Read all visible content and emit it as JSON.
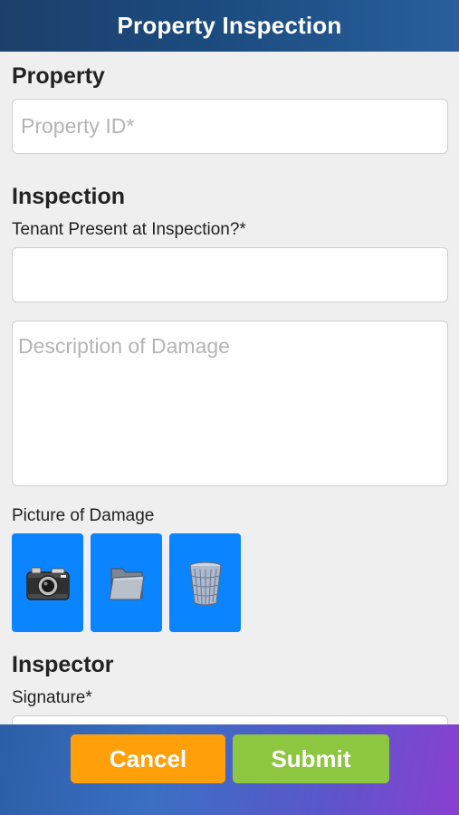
{
  "header": {
    "title": "Property Inspection"
  },
  "property": {
    "section_title": "Property",
    "property_id_placeholder": "Property ID*"
  },
  "inspection": {
    "section_title": "Inspection",
    "tenant_present_label": "Tenant Present at Inspection?*",
    "tenant_present_value": "",
    "description_placeholder": "Description of Damage",
    "picture_label": "Picture of Damage",
    "picture_actions": [
      {
        "icon": "camera-icon"
      },
      {
        "icon": "folder-icon"
      },
      {
        "icon": "trash-icon"
      }
    ]
  },
  "inspector": {
    "section_title": "Inspector",
    "signature_label": "Signature*"
  },
  "footer": {
    "cancel_label": "Cancel",
    "submit_label": "Submit"
  },
  "colors": {
    "header": "#1b4b7e",
    "tile_blue": "#0a84ff",
    "cancel": "#ff9f0a",
    "submit": "#8dc63f",
    "placeholder": "#b4b4b4"
  }
}
